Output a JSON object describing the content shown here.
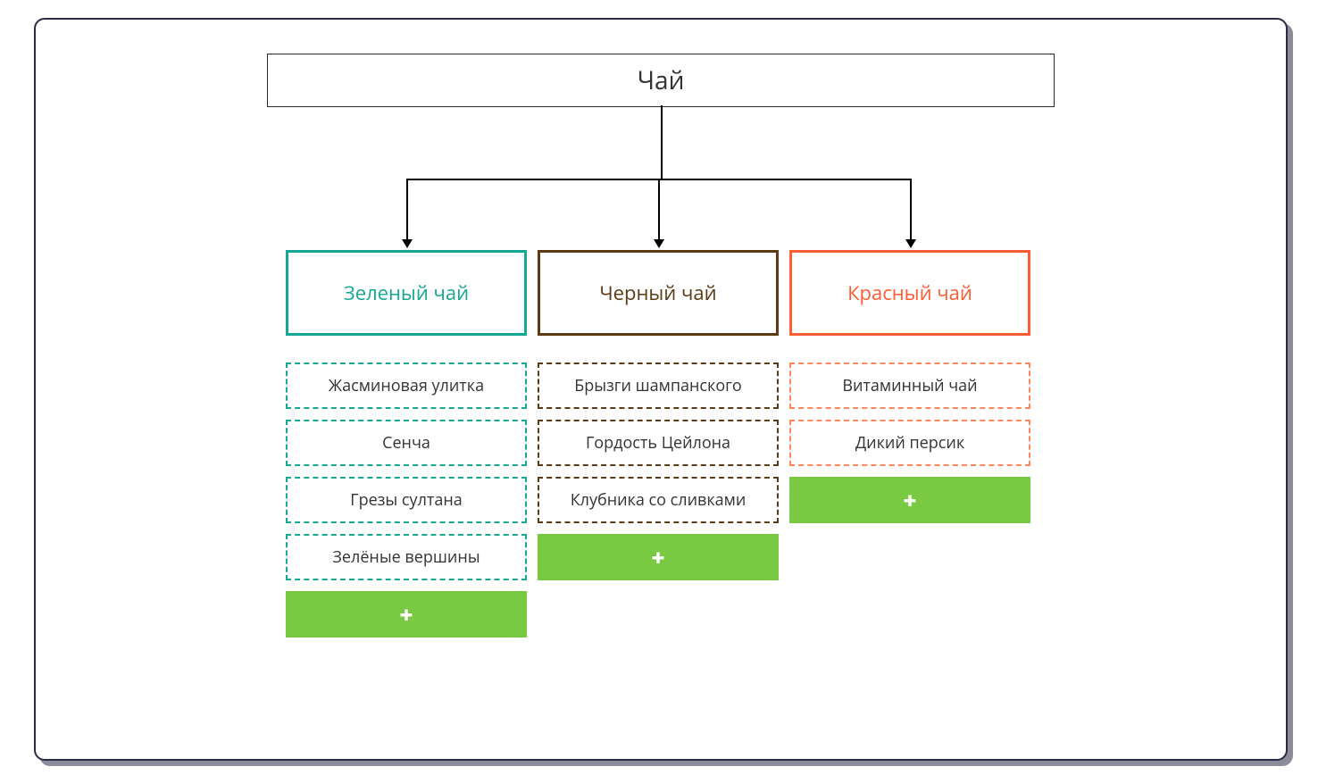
{
  "root": {
    "label": "Чай"
  },
  "colors": {
    "green": "#15a993",
    "brown": "#5c3a15",
    "orange": "#ff5c33",
    "add": "#7ac943"
  },
  "columns": [
    {
      "id": "green-tea",
      "header": "Зеленый чай",
      "items": [
        "Жасминовая улитка",
        "Сенча",
        "Грезы султана",
        "Зелёные вершины"
      ]
    },
    {
      "id": "black-tea",
      "header": "Черный чай",
      "items": [
        "Брызги шампанского",
        "Гордость Цейлона",
        "Клубника со сливками"
      ]
    },
    {
      "id": "red-tea",
      "header": "Красный чай",
      "items": [
        "Витаминный чай",
        "Дикий персик"
      ]
    }
  ],
  "add_symbol": "+"
}
